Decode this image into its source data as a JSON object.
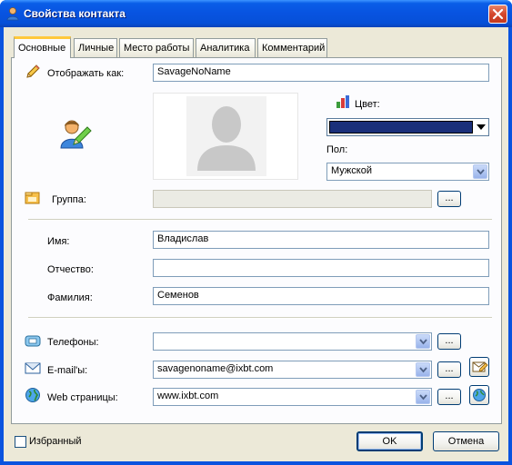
{
  "window": {
    "title": "Свойства контакта",
    "close_icon": "close-icon"
  },
  "tabs": [
    {
      "label": "Основные",
      "active": true
    },
    {
      "label": "Личные",
      "active": false
    },
    {
      "label": "Место работы",
      "active": false
    },
    {
      "label": "Аналитика",
      "active": false
    },
    {
      "label": "Комментарий",
      "active": false
    }
  ],
  "display_as": {
    "label": "Отображать как:",
    "value": "SavageNoName"
  },
  "color": {
    "label": "Цвет:",
    "value": "#1a2f7a"
  },
  "gender": {
    "label": "Пол:",
    "value": "Мужской"
  },
  "group": {
    "label": "Группа:",
    "value": "",
    "browse_label": "..."
  },
  "first_name": {
    "label": "Имя:",
    "value": "Владислав"
  },
  "middle_name": {
    "label": "Отчество:",
    "value": ""
  },
  "last_name": {
    "label": "Фамилия:",
    "value": "Семенов"
  },
  "phones": {
    "label": "Телефоны:",
    "value": "",
    "browse_label": "..."
  },
  "emails": {
    "label": "E-mail'ы:",
    "value": "savagenoname@ixbt.com",
    "browse_label": "..."
  },
  "web": {
    "label": "Web страницы:",
    "value": "www.ixbt.com",
    "browse_label": "..."
  },
  "footer": {
    "favorite_label": "Избранный",
    "favorite_checked": false,
    "ok_label": "OK",
    "cancel_label": "Отмена"
  }
}
